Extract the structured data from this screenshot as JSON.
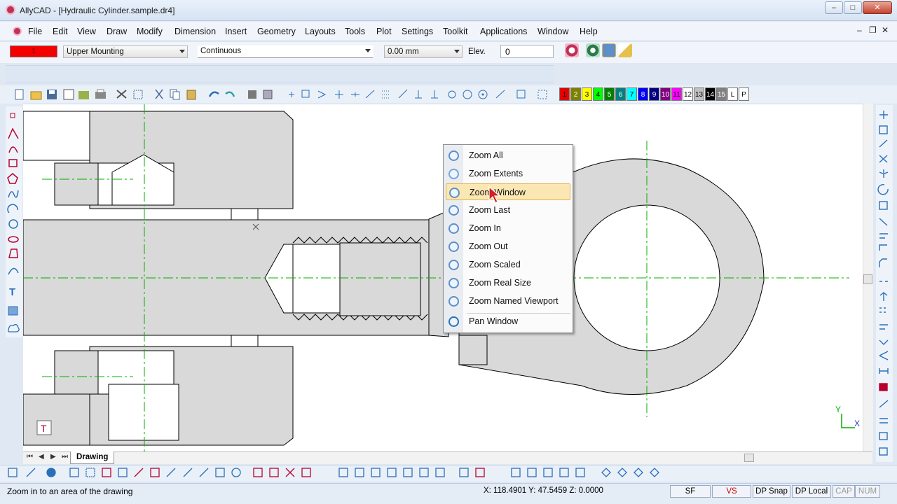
{
  "window": {
    "title": "AllyCAD - [Hydraulic Cylinder.sample.dr4]"
  },
  "menu": {
    "items": [
      "File",
      "Edit",
      "View",
      "Draw",
      "Modify",
      "Dimension",
      "Insert",
      "Geometry",
      "Layouts",
      "Tools",
      "Plot",
      "Settings",
      "Toolkit",
      "Applications",
      "Window",
      "Help"
    ]
  },
  "properties": {
    "color_value": "1",
    "layer": "Upper Mounting",
    "linetype": "Continuous",
    "lineweight": "0.00 mm",
    "elev_label": "Elev.",
    "elev_value": "0"
  },
  "palette": {
    "colors": [
      {
        "label": "1",
        "color": "#e60000"
      },
      {
        "label": "2",
        "color": "#808000"
      },
      {
        "label": "3",
        "color": "#ffff00"
      },
      {
        "label": "4",
        "color": "#00ff00"
      },
      {
        "label": "5",
        "color": "#008000"
      },
      {
        "label": "6",
        "color": "#008080"
      },
      {
        "label": "7",
        "color": "#00ffff"
      },
      {
        "label": "8",
        "color": "#0000ff"
      },
      {
        "label": "9",
        "color": "#000080"
      },
      {
        "label": "10",
        "color": "#800080"
      },
      {
        "label": "11",
        "color": "#ff00ff"
      },
      {
        "label": "12",
        "color": "#ffffff"
      },
      {
        "label": "13",
        "color": "#c0c0c0"
      },
      {
        "label": "14",
        "color": "#000000"
      },
      {
        "label": "15",
        "color": "#808080"
      },
      {
        "label": "L",
        "color": "#ffffff"
      },
      {
        "label": "P",
        "color": "#ffffff"
      }
    ]
  },
  "context_menu": {
    "items": [
      {
        "label": "Zoom All",
        "icon": "zoom-all-icon"
      },
      {
        "label": "Zoom Extents",
        "icon": "zoom-extents-icon"
      },
      {
        "label": "Zoom Window",
        "icon": "zoom-window-icon",
        "highlighted": true
      },
      {
        "label": "Zoom Last",
        "icon": "zoom-last-icon"
      },
      {
        "label": "Zoom In",
        "icon": "zoom-in-icon"
      },
      {
        "label": "Zoom Out",
        "icon": "zoom-out-icon"
      },
      {
        "label": "Zoom Scaled",
        "icon": "zoom-scaled-icon"
      },
      {
        "label": "Zoom Real Size",
        "icon": "zoom-real-size-icon"
      },
      {
        "label": "Zoom Named Viewport",
        "icon": "zoom-named-viewport-icon"
      },
      {
        "label": "Pan Window",
        "icon": "pan-window-icon"
      }
    ]
  },
  "tabs": {
    "sheet": "Drawing"
  },
  "status": {
    "message": "Zoom in to an area of the drawing",
    "coordinates": "X: 118.4901 Y: 47.5459 Z: 0.0000",
    "buttons": [
      "SF",
      "VS",
      "DP Snap",
      "DP Local",
      "CAP",
      "NUM"
    ]
  },
  "drawing": {
    "axis_y": "Y",
    "axis_x": "X",
    "marker_T": "T"
  },
  "colors": {
    "accent_red": "#e60000",
    "highlight": "#fbe7b3",
    "centerline": "#00b000",
    "part_fill": "#d9d9d9"
  }
}
